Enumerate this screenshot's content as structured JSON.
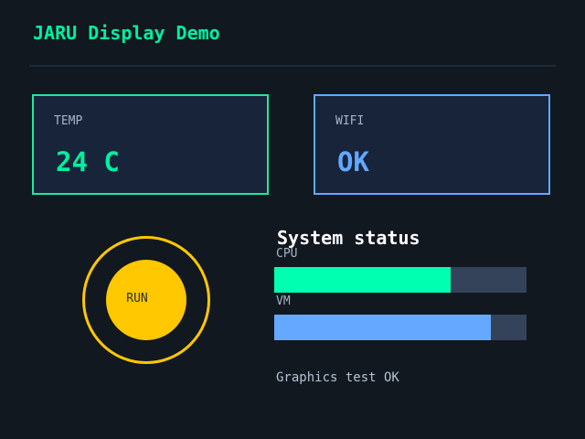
{
  "app": {
    "title": "JARU Display Demo"
  },
  "cards": {
    "temp": {
      "label": "TEMP",
      "value": "24 C"
    },
    "wifi": {
      "label": "WIFI",
      "value": "OK"
    }
  },
  "indicator": {
    "label": "RUN",
    "icon": "run-status-indicator"
  },
  "system_status": {
    "title": "System status",
    "bars": {
      "cpu": {
        "label": "CPU",
        "level": 0.7
      },
      "vm": {
        "label": "VM",
        "level": 0.86
      }
    }
  },
  "footer": {
    "message": "Graphics test OK"
  },
  "colors": {
    "background": "#111820",
    "accent_green": "#00f0a0",
    "accent_blue": "#64a8ff",
    "accent_yellow": "#ffc800",
    "card_background": "#18243a",
    "bar_track": "#34435a"
  }
}
